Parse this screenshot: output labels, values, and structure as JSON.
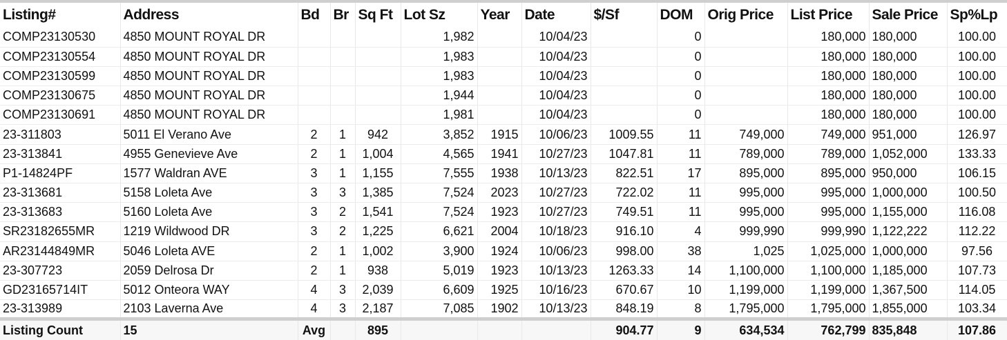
{
  "columns": [
    "Listing#",
    "Address",
    "Bd",
    "Br",
    "Sq Ft",
    "Lot Sz",
    "Year",
    "Date",
    "$/Sf",
    "DOM",
    "Orig Price",
    "List Price",
    "Sale Price",
    "Sp%Lp"
  ],
  "rows": [
    [
      "COMP23130530",
      "4850 MOUNT ROYAL DR",
      "",
      "",
      "",
      "1,982",
      "",
      "10/04/23",
      "",
      "0",
      "",
      "180,000",
      "180,000",
      "100.00"
    ],
    [
      "COMP23130554",
      "4850 MOUNT ROYAL DR",
      "",
      "",
      "",
      "1,983",
      "",
      "10/04/23",
      "",
      "0",
      "",
      "180,000",
      "180,000",
      "100.00"
    ],
    [
      "COMP23130599",
      "4850 MOUNT ROYAL DR",
      "",
      "",
      "",
      "1,983",
      "",
      "10/04/23",
      "",
      "0",
      "",
      "180,000",
      "180,000",
      "100.00"
    ],
    [
      "COMP23130675",
      "4850 MOUNT ROYAL DR",
      "",
      "",
      "",
      "1,944",
      "",
      "10/04/23",
      "",
      "0",
      "",
      "180,000",
      "180,000",
      "100.00"
    ],
    [
      "COMP23130691",
      "4850 MOUNT ROYAL DR",
      "",
      "",
      "",
      "1,981",
      "",
      "10/04/23",
      "",
      "0",
      "",
      "180,000",
      "180,000",
      "100.00"
    ],
    [
      "23-311803",
      "5011 El Verano Ave",
      "2",
      "1",
      "942",
      "3,852",
      "1915",
      "10/06/23",
      "1009.55",
      "11",
      "749,000",
      "749,000",
      "951,000",
      "126.97"
    ],
    [
      "23-313841",
      "4955 Genevieve Ave",
      "2",
      "1",
      "1,004",
      "4,565",
      "1941",
      "10/27/23",
      "1047.81",
      "11",
      "789,000",
      "789,000",
      "1,052,000",
      "133.33"
    ],
    [
      "P1-14824PF",
      "1577 Waldran AVE",
      "3",
      "1",
      "1,155",
      "7,555",
      "1938",
      "10/13/23",
      "822.51",
      "17",
      "895,000",
      "895,000",
      "950,000",
      "106.15"
    ],
    [
      "23-313681",
      "5158 Loleta Ave",
      "3",
      "3",
      "1,385",
      "7,524",
      "2023",
      "10/27/23",
      "722.02",
      "11",
      "995,000",
      "995,000",
      "1,000,000",
      "100.50"
    ],
    [
      "23-313683",
      "5160 Loleta Ave",
      "3",
      "2",
      "1,541",
      "7,524",
      "1923",
      "10/27/23",
      "749.51",
      "11",
      "995,000",
      "995,000",
      "1,155,000",
      "116.08"
    ],
    [
      "SR23182655MR",
      "1219 Wildwood DR",
      "3",
      "2",
      "1,225",
      "6,621",
      "2004",
      "10/18/23",
      "916.10",
      "4",
      "999,990",
      "999,990",
      "1,122,222",
      "112.22"
    ],
    [
      "AR23144849MR",
      "5046 Loleta AVE",
      "2",
      "1",
      "1,002",
      "3,900",
      "1924",
      "10/06/23",
      "998.00",
      "38",
      "1,025",
      "1,025,000",
      "1,000,000",
      "97.56"
    ],
    [
      "23-307723",
      "2059 Delrosa Dr",
      "2",
      "1",
      "938",
      "5,019",
      "1923",
      "10/13/23",
      "1263.33",
      "14",
      "1,100,000",
      "1,100,000",
      "1,185,000",
      "107.73"
    ],
    [
      "GD23165714IT",
      "5012 Onteora WAY",
      "4",
      "3",
      "2,039",
      "6,609",
      "1925",
      "10/16/23",
      "670.67",
      "10",
      "1,199,000",
      "1,199,000",
      "1,367,500",
      "114.05"
    ],
    [
      "23-313989",
      "2103 Laverna Ave",
      "4",
      "3",
      "2,187",
      "7,085",
      "1902",
      "10/13/23",
      "848.19",
      "8",
      "1,795,000",
      "1,795,000",
      "1,855,000",
      "103.34"
    ]
  ],
  "footer": [
    "Listing Count",
    "15",
    "Avg",
    "",
    "895",
    "",
    "",
    "",
    "904.77",
    "9",
    "634,534",
    "762,799",
    "835,848",
    "107.86"
  ]
}
